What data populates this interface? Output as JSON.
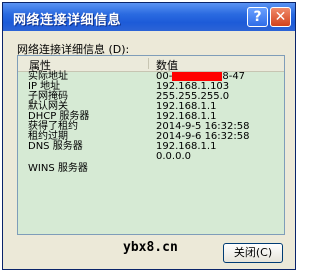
{
  "window": {
    "title": "网络连接详细信息",
    "help_glyph": "?",
    "close_glyph": "✕"
  },
  "caption": "网络连接详细信息 (D):",
  "list": {
    "columns": [
      "属性",
      "数值"
    ],
    "rows": [
      {
        "property": "实际地址",
        "value_prefix": "00-",
        "value_suffix": "8-47",
        "redacted": true
      },
      {
        "property": "IP 地址",
        "value": "192.168.1.103"
      },
      {
        "property": "子网掩码",
        "value": "255.255.255.0"
      },
      {
        "property": "默认网关",
        "value": "192.168.1.1"
      },
      {
        "property": "DHCP 服务器",
        "value": "192.168.1.1"
      },
      {
        "property": "获得了租约",
        "value": "2014-9-5 16:32:58"
      },
      {
        "property": "租约过期",
        "value": "2014-9-6 16:32:58"
      },
      {
        "property": "DNS 服务器",
        "value": "192.168.1.1"
      },
      {
        "property": "",
        "value": "0.0.0.0"
      },
      {
        "property": "WINS 服务器",
        "value": ""
      }
    ]
  },
  "watermark": "ybx8.cn",
  "close_button": "关闭(C)",
  "colors": {
    "list_background": "#d6ead4",
    "redaction": "#ff0000",
    "titlebar": "#2a6ae0"
  }
}
